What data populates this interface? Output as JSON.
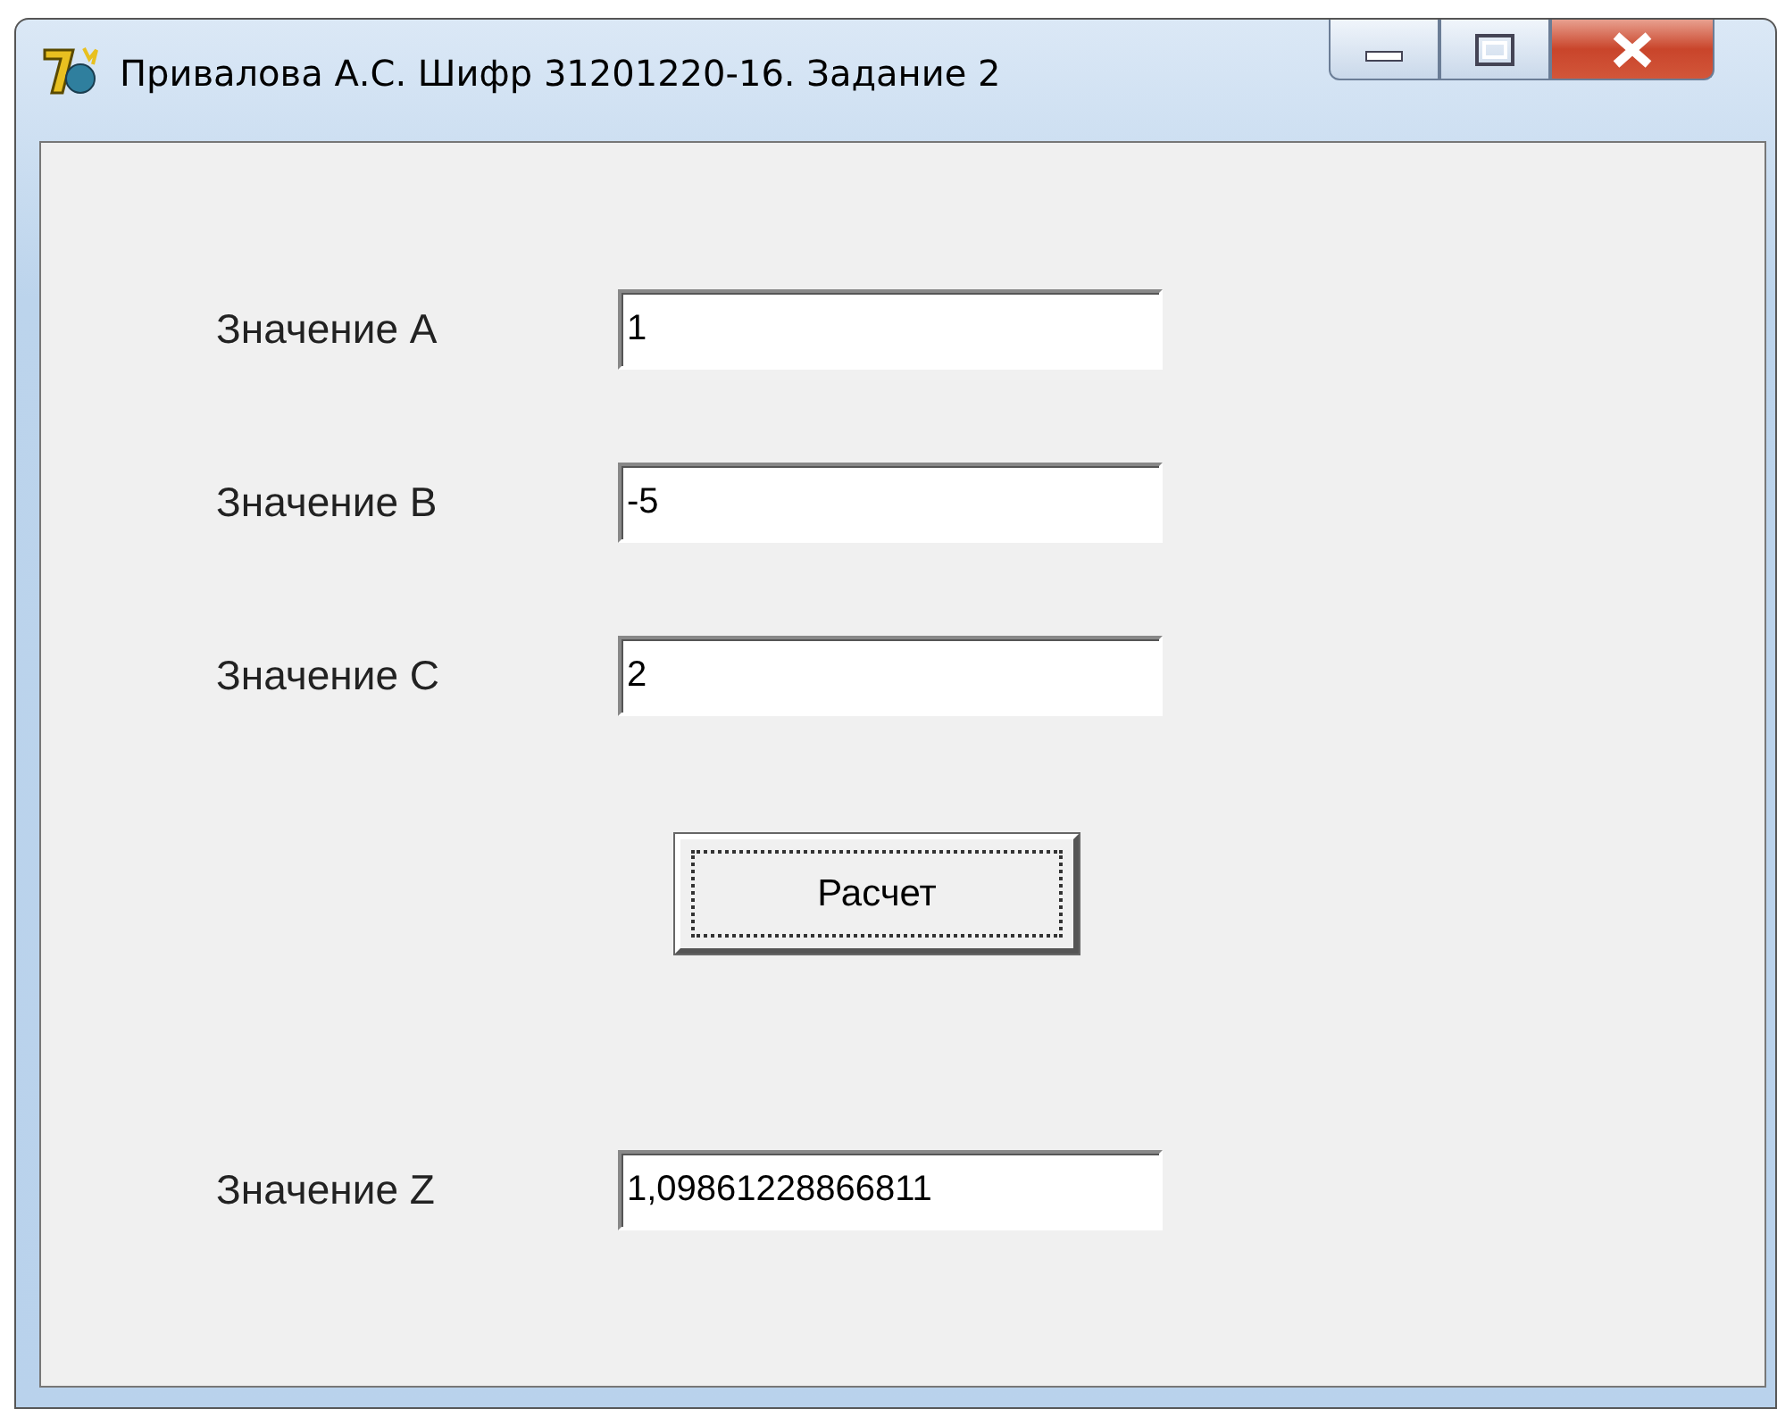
{
  "window": {
    "title": "Привалова А.С. Шифр 31201220-16. Задание 2"
  },
  "fields": [
    {
      "label": "Значение A",
      "value": "1"
    },
    {
      "label": "Значение B",
      "value": "-5"
    },
    {
      "label": "Значение C",
      "value": "2"
    }
  ],
  "button": {
    "label": "Расчет",
    "focused": true
  },
  "result": {
    "label": "Значение Z",
    "value": "1,09861228866811"
  }
}
